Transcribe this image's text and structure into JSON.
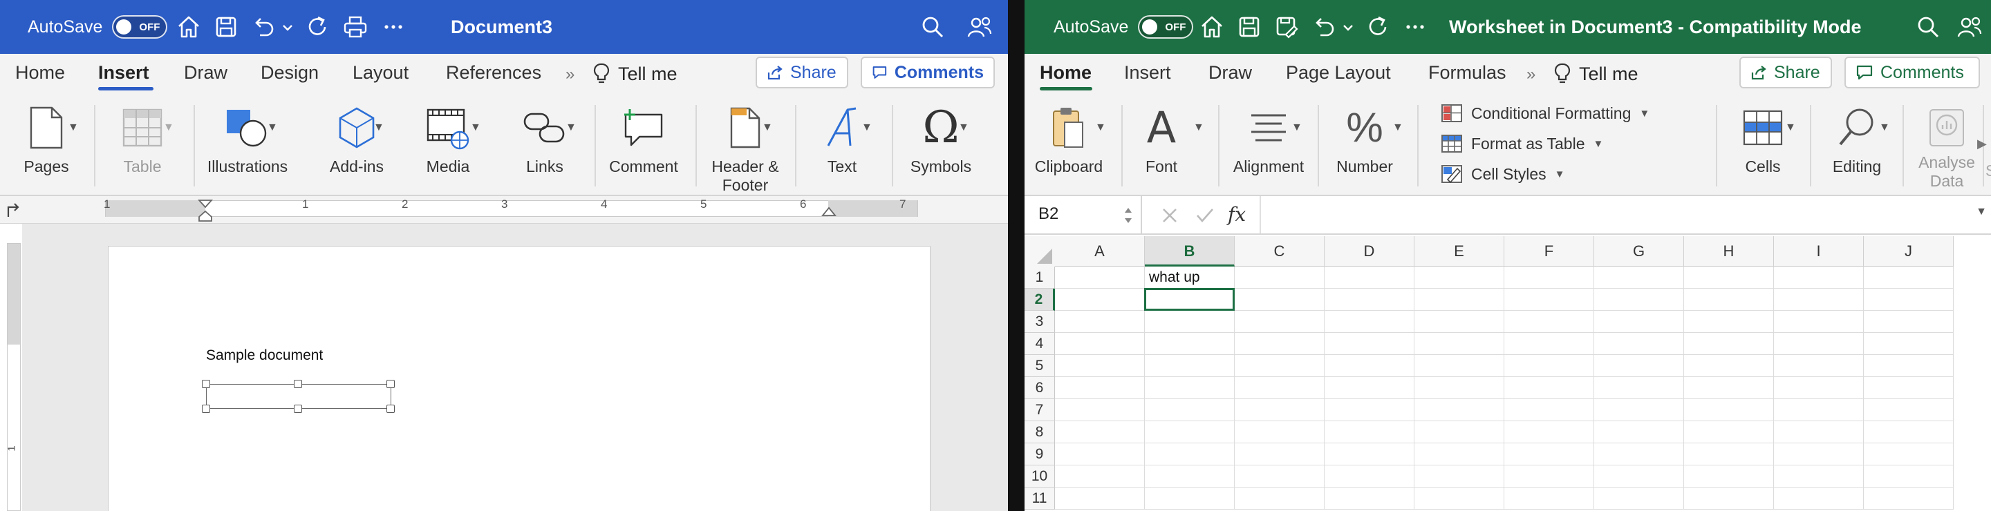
{
  "word": {
    "autosave_label": "AutoSave",
    "toggle_label": "OFF",
    "title": "Document3",
    "tabs": [
      "Home",
      "Insert",
      "Draw",
      "Design",
      "Layout",
      "References"
    ],
    "tell_me": "Tell me",
    "share_label": "Share",
    "comments_label": "Comments",
    "ribbon": {
      "pages": "Pages",
      "table": "Table",
      "illustrations": "Illustrations",
      "addins": "Add-ins",
      "media": "Media",
      "links": "Links",
      "comment": "Comment",
      "header_footer_1": "Header &",
      "header_footer_2": "Footer",
      "text": "Text",
      "symbols": "Symbols"
    },
    "ruler_numbers": [
      "1",
      "1",
      "2",
      "3",
      "4",
      "5",
      "6",
      "7"
    ],
    "vruler_numbers": [
      "1"
    ],
    "document_text": "Sample document",
    "accent": "#2c5cc5"
  },
  "excel": {
    "autosave_label": "AutoSave",
    "toggle_label": "OFF",
    "title": "Worksheet in Document3  -  Compatibility Mode",
    "tabs": [
      "Home",
      "Insert",
      "Draw",
      "Page Layout",
      "Formulas"
    ],
    "tell_me": "Tell me",
    "share_label": "Share",
    "comments_label": "Comments",
    "ribbon": {
      "clipboard": "Clipboard",
      "font": "Font",
      "alignment": "Alignment",
      "number": "Number",
      "conditional_formatting": "Conditional Formatting",
      "format_as_table": "Format as Table",
      "cell_styles": "Cell Styles",
      "cells": "Cells",
      "editing": "Editing",
      "analyse_data_1": "Analyse",
      "analyse_data_2": "Data",
      "truncated": "S"
    },
    "name_box": "B2",
    "formula_fx": "fx",
    "columns": [
      "A",
      "B",
      "C",
      "D",
      "E",
      "F",
      "G",
      "H",
      "I",
      "J"
    ],
    "rows": [
      "1",
      "2",
      "3",
      "4",
      "5",
      "6",
      "7",
      "8",
      "9",
      "10",
      "11"
    ],
    "cells": {
      "B1": "what up"
    },
    "selected_cell": "B2",
    "accent": "#1d7044"
  }
}
